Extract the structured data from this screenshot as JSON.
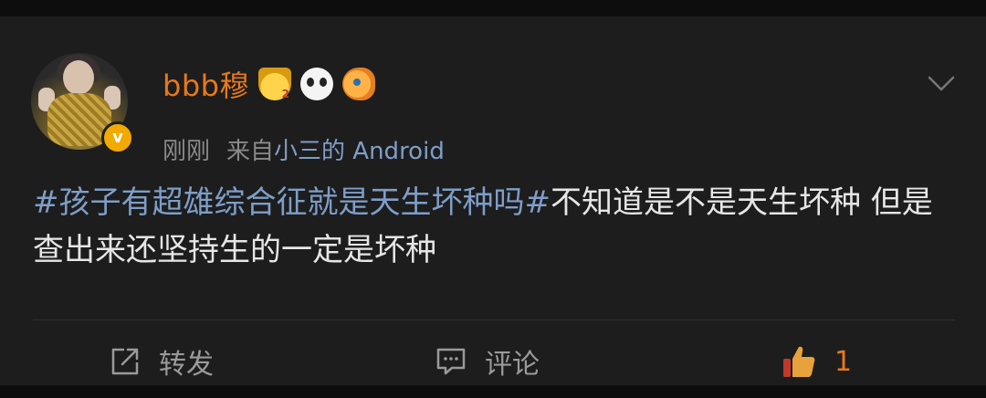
{
  "post": {
    "author": {
      "name": "bbb穆"
    },
    "meta": {
      "time": "刚刚",
      "from_prefix": "来自",
      "source": "小三的 Android"
    },
    "verified_label": "v",
    "content": {
      "topic": "#孩子有超雄综合征就是天生坏种吗#",
      "text": "不知道是不是天生坏种 但是查出来还坚持生的一定是坏种"
    },
    "actions": {
      "repost_label": "转发",
      "comment_label": "评论",
      "like_count": "1"
    }
  },
  "colors": {
    "username": "#e8791a",
    "link": "#7e9ec8",
    "background": "#1d1d1d",
    "like_active": "#e8791a"
  },
  "icons": [
    "crown-level-badge-icon",
    "panda-badge-icon",
    "fish-badge-icon",
    "chevron-down-icon",
    "repost-icon",
    "comment-icon",
    "thumbs-up-icon"
  ]
}
